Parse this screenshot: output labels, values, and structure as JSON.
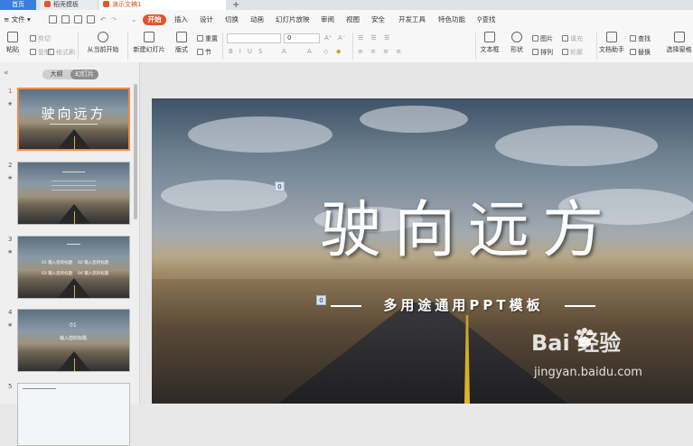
{
  "tabs": {
    "home": "首页",
    "template": "稻壳模板",
    "doc": "演示文稿1",
    "add": "+"
  },
  "menu": {
    "file": "文件",
    "start": "开始",
    "items": [
      "插入",
      "设计",
      "切换",
      "动画",
      "幻灯片放映",
      "审阅",
      "视图",
      "安全",
      "开发工具",
      "特色功能"
    ],
    "search": "查找"
  },
  "ribbon": {
    "paste": "粘贴",
    "cut": "剪切",
    "copy": "复制",
    "format_painter": "格式刷",
    "from_current": "从当前开始",
    "new_slide": "新建幻灯片",
    "layout": "版式",
    "reset": "重置",
    "section": "节",
    "font_size": "0",
    "textbox": "文本框",
    "shape": "形状",
    "picture": "图片",
    "fill": "填充",
    "arrange": "排列",
    "outline": "轮廓",
    "find": "查找",
    "replace": "替换",
    "doc_assistant": "文档助手",
    "select_pane": "选择窗格"
  },
  "panel": {
    "collapse": "«",
    "outline_tab": "大纲",
    "slides_tab": "幻灯片",
    "slide_numbers": [
      "1",
      "2",
      "3",
      "4",
      "5"
    ],
    "thumb1_title": "驶向远方",
    "thumb3_items": [
      "01 输入您的标题",
      "02 输入您的标题",
      "03 输入您的标题",
      "04 输入您的标题"
    ],
    "thumb4_num": "01",
    "thumb4_title": "输入您的标题"
  },
  "slide": {
    "title": "驶向远方",
    "subtitle": "多用途通用PPT模板",
    "badge1": "0",
    "badge2": "0"
  },
  "watermark": {
    "logo": "Bai  经验",
    "url": "jingyan.baidu.com"
  }
}
